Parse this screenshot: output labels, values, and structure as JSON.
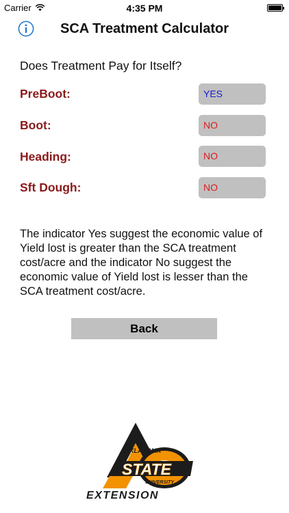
{
  "status_bar": {
    "carrier": "Carrier",
    "time": "4:35 PM"
  },
  "header": {
    "title": "SCA Treatment Calculator",
    "info_icon": "info-circle-icon"
  },
  "question": "Does Treatment Pay for Itself?",
  "rows": [
    {
      "label": "PreBoot:",
      "value": "YES"
    },
    {
      "label": "Boot:",
      "value": "NO"
    },
    {
      "label": "Heading:",
      "value": "NO"
    },
    {
      "label": "Sft Dough:",
      "value": "NO"
    }
  ],
  "explanation": "The indicator Yes suggest the economic value of Yield lost is greater than the SCA treatment cost/acre and the indicator No suggest the economic value of Yield lost is lesser than the SCA treatment cost/acre.",
  "back_label": "Back",
  "logo": {
    "line1": "OKLAHOMA",
    "line2": "STATE",
    "line3": "UNIVERSITY",
    "line4": "EXTENSION"
  },
  "colors": {
    "accent": "#1a73c9",
    "label": "#8b1a1a",
    "yes": "#1a1ad4",
    "no": "#e01a1a",
    "orange": "#f39200"
  }
}
